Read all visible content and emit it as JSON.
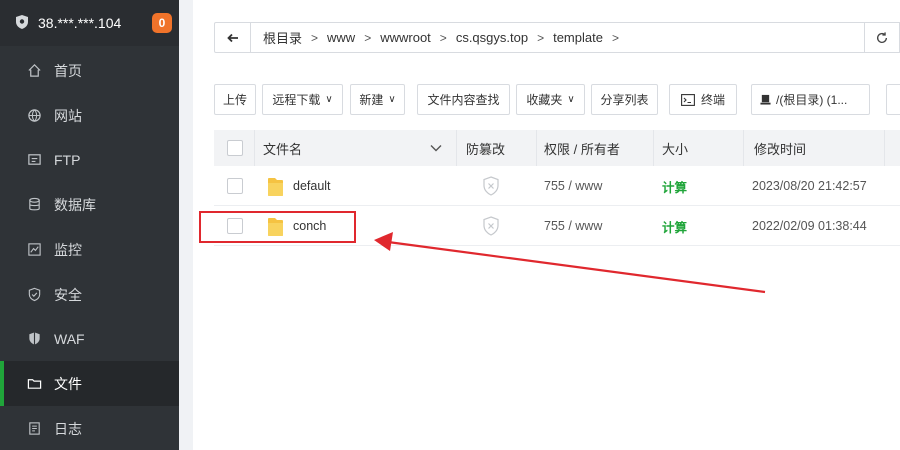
{
  "server": {
    "ip": "38.***.***.104",
    "badge": "0"
  },
  "sidebar": {
    "items": [
      {
        "label": "首页",
        "icon": "home-icon"
      },
      {
        "label": "网站",
        "icon": "globe-icon"
      },
      {
        "label": "FTP",
        "icon": "ftp-icon"
      },
      {
        "label": "数据库",
        "icon": "database-icon"
      },
      {
        "label": "监控",
        "icon": "monitor-icon"
      },
      {
        "label": "安全",
        "icon": "shield-icon"
      },
      {
        "label": "WAF",
        "icon": "waf-shield-icon"
      },
      {
        "label": "文件",
        "icon": "folder-icon",
        "active": true
      },
      {
        "label": "日志",
        "icon": "log-icon"
      }
    ]
  },
  "breadcrumb": [
    "根目录",
    "www",
    "wwwroot",
    "cs.qsgys.top",
    "template"
  ],
  "toolbar": {
    "upload": "上传",
    "remote_download": "远程下载",
    "new": "新建",
    "content_search": "文件内容查找",
    "favorites": "收藏夹",
    "share_list": "分享列表",
    "terminal": "终端",
    "disk": "/(根目录) (1..."
  },
  "table": {
    "headers": {
      "name": "文件名",
      "tamper": "防篡改",
      "perm": "权限 / 所有者",
      "size": "大小",
      "mtime": "修改时间"
    },
    "rows": [
      {
        "name": "default",
        "perm": "755 / www",
        "size": "计算",
        "mtime": "2023/08/20 21:42:57"
      },
      {
        "name": "conch",
        "perm": "755 / www",
        "size": "计算",
        "mtime": "2022/02/09 01:38:44"
      }
    ]
  },
  "colors": {
    "accent": "#20a53a",
    "sidebar": "#2f3337",
    "badge": "#f0732a",
    "annotation": "#e0282e"
  }
}
